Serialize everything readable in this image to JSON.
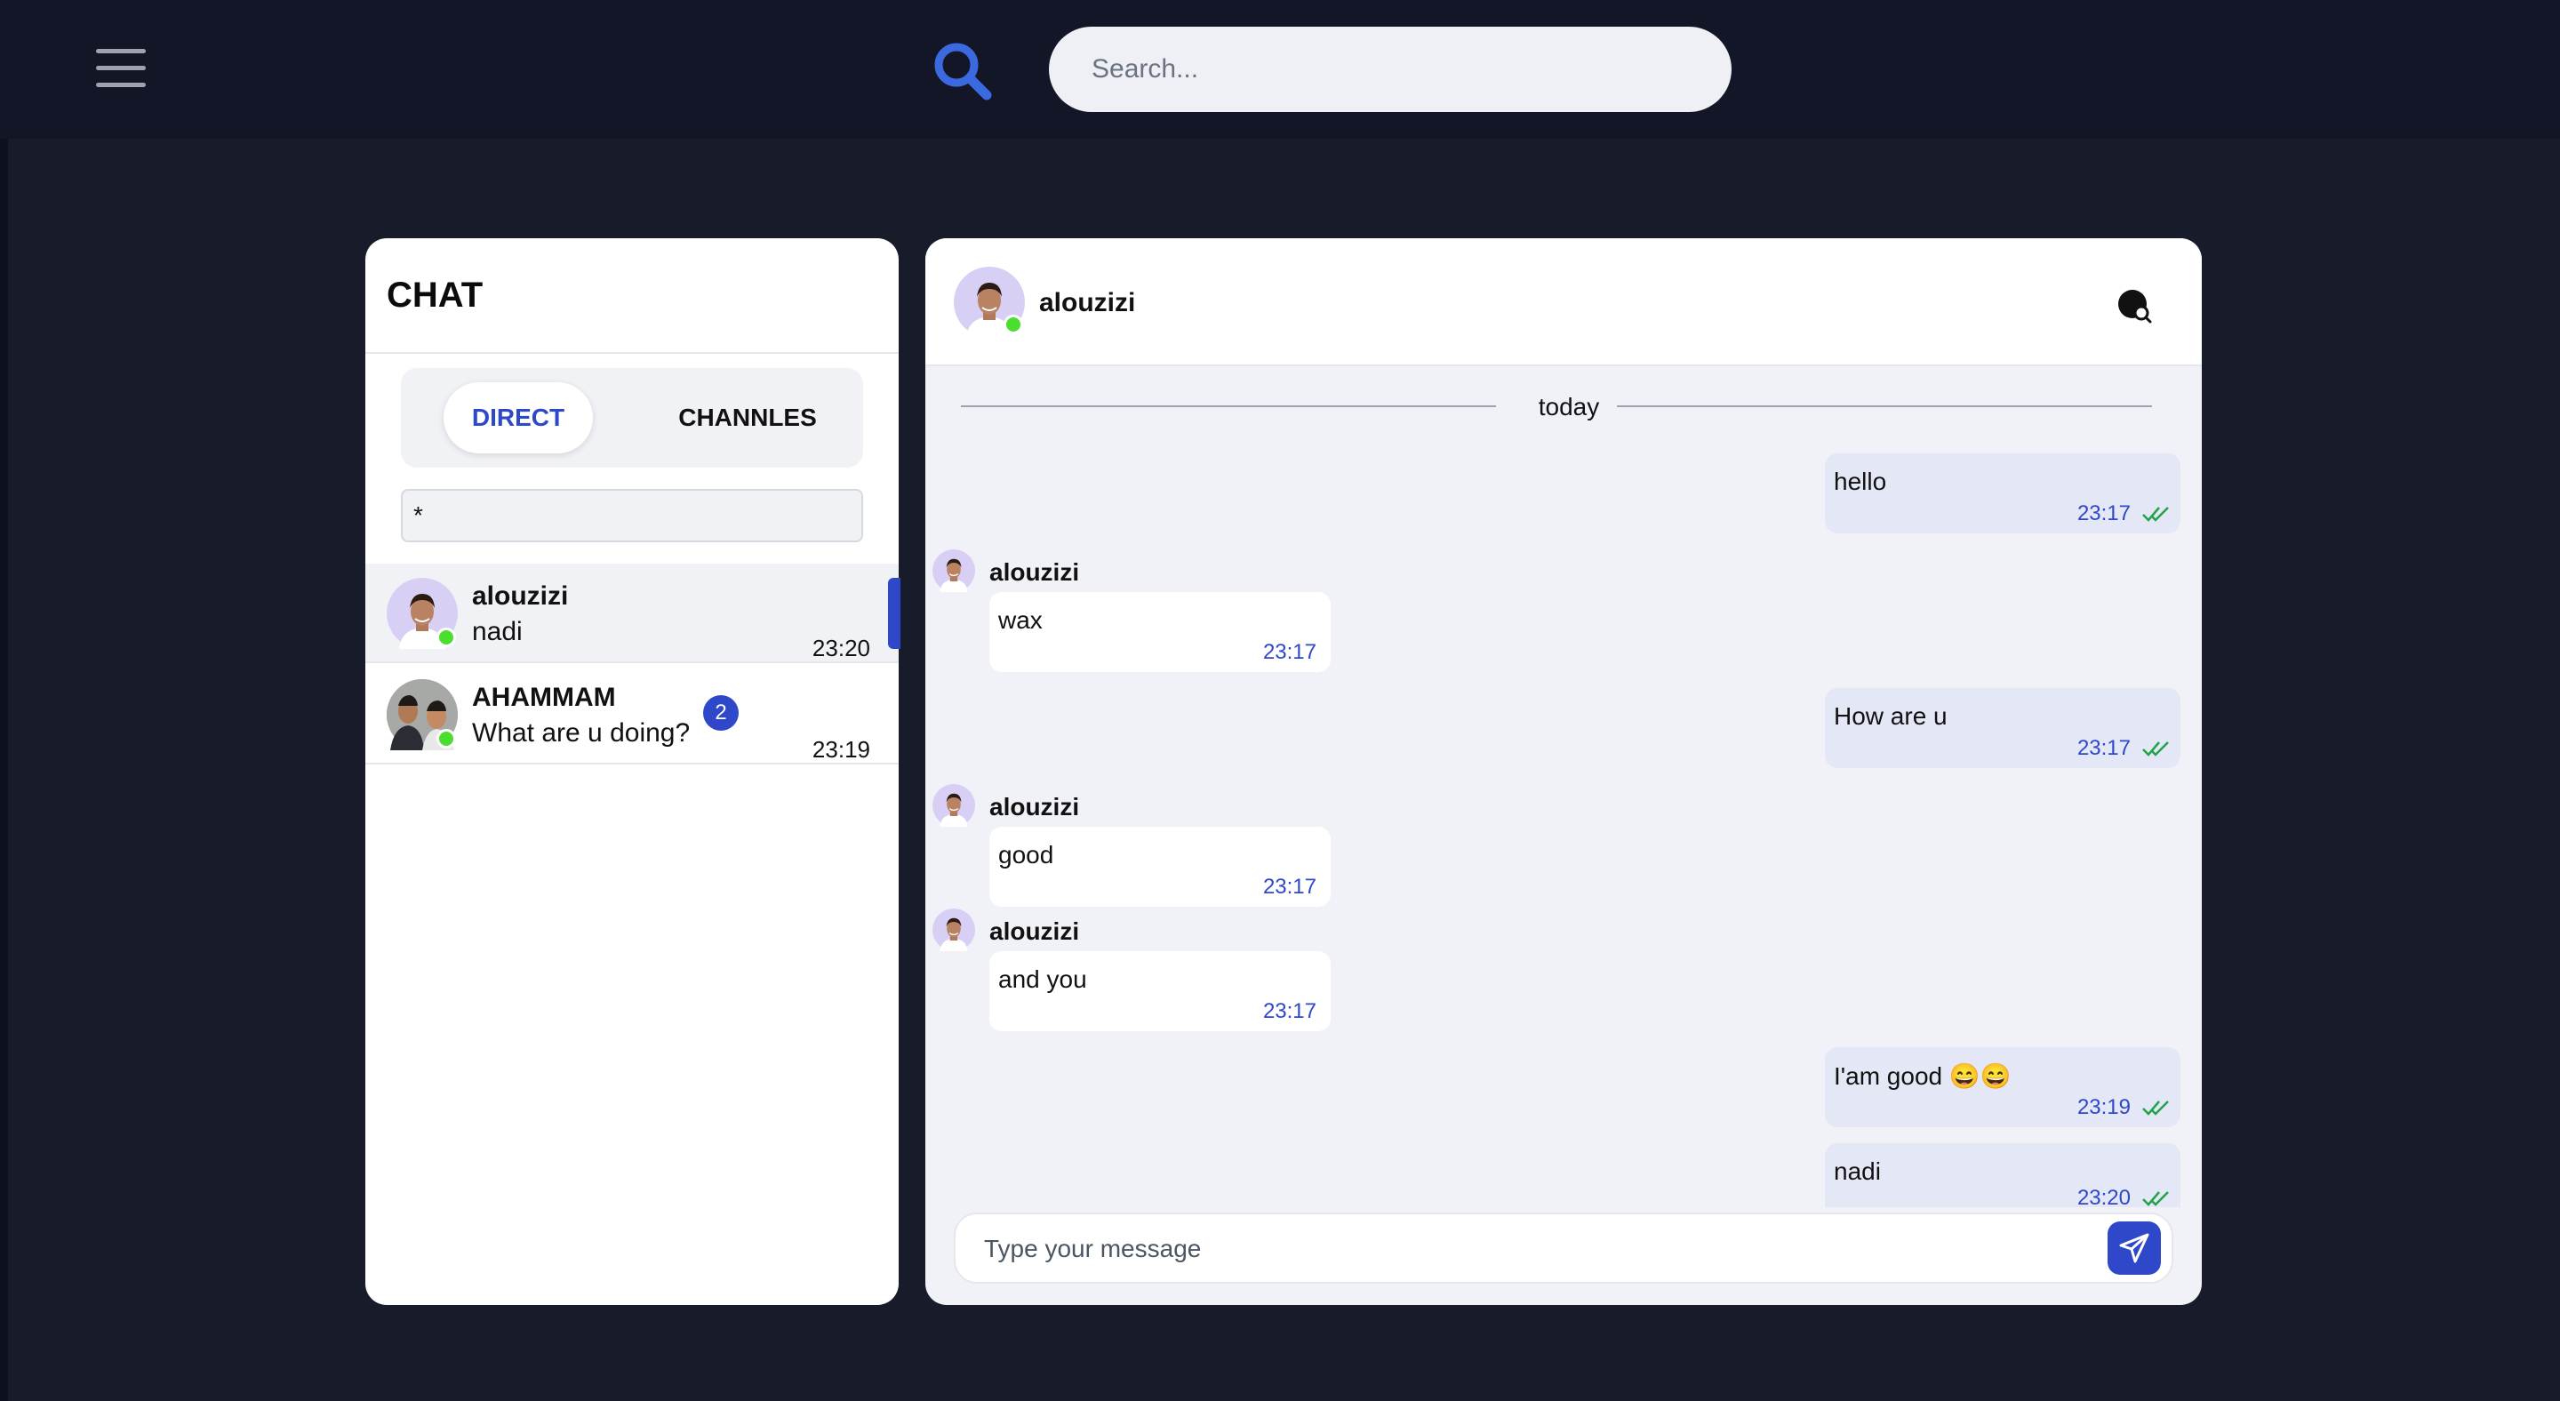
{
  "topbar": {
    "menu_icon": "hamburger-menu-icon",
    "search_icon": "search-icon",
    "search_placeholder": "Search..."
  },
  "sidebar": {
    "title": "CHAT",
    "tabs": [
      {
        "label": "DIRECT",
        "active": true
      },
      {
        "label": "CHANNLES",
        "active": false
      }
    ],
    "filter_value": "*",
    "conversations": [
      {
        "name": "alouzizi",
        "last_message": "nadi",
        "time": "23:20",
        "online": true,
        "active": true
      },
      {
        "name": "AHAMMAM",
        "last_message": "What are u doing?",
        "time": "23:19",
        "unread": "2",
        "online": true
      }
    ]
  },
  "conversation": {
    "contact_name": "alouzizi",
    "header_icon": "user-search-icon",
    "day_label": "today",
    "messages": [
      {
        "direction": "out",
        "text": "hello",
        "time": "23:17",
        "read": true
      },
      {
        "direction": "in",
        "sender": "alouzizi",
        "text": "wax",
        "time": "23:17"
      },
      {
        "direction": "out",
        "text": "How are u",
        "time": "23:17",
        "read": true
      },
      {
        "direction": "in",
        "sender": "alouzizi",
        "text": "good",
        "time": "23:17"
      },
      {
        "direction": "in",
        "sender": "alouzizi",
        "text": "and you",
        "time": "23:17"
      },
      {
        "direction": "out",
        "text": "I'am good 😄😄",
        "time": "23:19",
        "read": true
      },
      {
        "direction": "out",
        "text": "nadi",
        "time": "23:20",
        "read": true
      }
    ],
    "composer": {
      "placeholder": "Type your message",
      "send_icon": "send-icon"
    }
  },
  "colors": {
    "accent": "#2f48c9",
    "online": "#4ade2f",
    "read_tick": "#22a34a"
  }
}
